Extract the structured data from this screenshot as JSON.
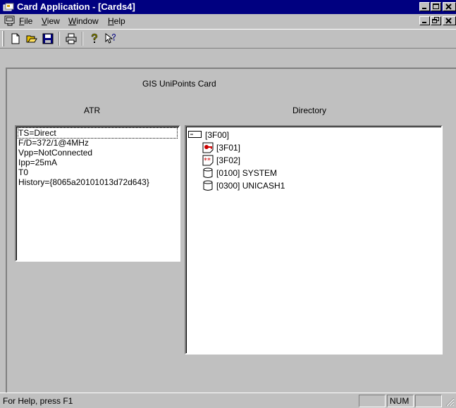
{
  "window": {
    "title": "Card Application - [Cards4]"
  },
  "menu": {
    "items": [
      "File",
      "View",
      "Window",
      "Help"
    ]
  },
  "toolbar": {
    "buttons": [
      "new-icon",
      "open-icon",
      "save-icon",
      "print-icon",
      "about-icon",
      "context-help-icon"
    ]
  },
  "card": {
    "name": "GIS UniPoints Card"
  },
  "atr": {
    "label": "ATR",
    "lines": [
      "TS=Direct",
      "F/D=372/1@4MHz",
      "Vpp=NotConnected",
      "Ipp=25mA",
      "T0",
      "History={8065a20101013d72d643}"
    ]
  },
  "directory": {
    "label": "Directory",
    "items": [
      {
        "label": "[3F00]",
        "icon": "folder-node-icon"
      },
      {
        "label": "[3F01]",
        "icon": "key-file-icon"
      },
      {
        "label": "[3F02]",
        "icon": "pin-file-icon"
      },
      {
        "label": "[0100] SYSTEM",
        "icon": "database-icon"
      },
      {
        "label": "[0300] UNICASH1",
        "icon": "database-icon"
      }
    ]
  },
  "status": {
    "help": "For Help, press F1",
    "num": "NUM"
  },
  "colors": {
    "titlebar": "#000080",
    "face": "#c0c0c0",
    "key": "#cc0000"
  }
}
